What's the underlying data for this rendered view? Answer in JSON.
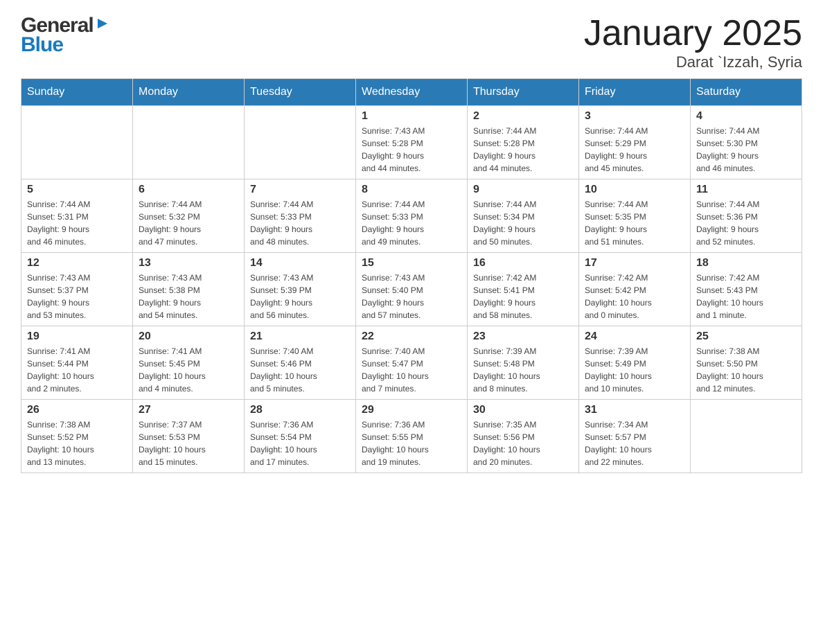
{
  "header": {
    "logo_general": "General",
    "logo_blue": "Blue",
    "title": "January 2025",
    "subtitle": "Darat `Izzah, Syria"
  },
  "days_of_week": [
    "Sunday",
    "Monday",
    "Tuesday",
    "Wednesday",
    "Thursday",
    "Friday",
    "Saturday"
  ],
  "weeks": [
    [
      {
        "day": "",
        "info": ""
      },
      {
        "day": "",
        "info": ""
      },
      {
        "day": "",
        "info": ""
      },
      {
        "day": "1",
        "info": "Sunrise: 7:43 AM\nSunset: 5:28 PM\nDaylight: 9 hours\nand 44 minutes."
      },
      {
        "day": "2",
        "info": "Sunrise: 7:44 AM\nSunset: 5:28 PM\nDaylight: 9 hours\nand 44 minutes."
      },
      {
        "day": "3",
        "info": "Sunrise: 7:44 AM\nSunset: 5:29 PM\nDaylight: 9 hours\nand 45 minutes."
      },
      {
        "day": "4",
        "info": "Sunrise: 7:44 AM\nSunset: 5:30 PM\nDaylight: 9 hours\nand 46 minutes."
      }
    ],
    [
      {
        "day": "5",
        "info": "Sunrise: 7:44 AM\nSunset: 5:31 PM\nDaylight: 9 hours\nand 46 minutes."
      },
      {
        "day": "6",
        "info": "Sunrise: 7:44 AM\nSunset: 5:32 PM\nDaylight: 9 hours\nand 47 minutes."
      },
      {
        "day": "7",
        "info": "Sunrise: 7:44 AM\nSunset: 5:33 PM\nDaylight: 9 hours\nand 48 minutes."
      },
      {
        "day": "8",
        "info": "Sunrise: 7:44 AM\nSunset: 5:33 PM\nDaylight: 9 hours\nand 49 minutes."
      },
      {
        "day": "9",
        "info": "Sunrise: 7:44 AM\nSunset: 5:34 PM\nDaylight: 9 hours\nand 50 minutes."
      },
      {
        "day": "10",
        "info": "Sunrise: 7:44 AM\nSunset: 5:35 PM\nDaylight: 9 hours\nand 51 minutes."
      },
      {
        "day": "11",
        "info": "Sunrise: 7:44 AM\nSunset: 5:36 PM\nDaylight: 9 hours\nand 52 minutes."
      }
    ],
    [
      {
        "day": "12",
        "info": "Sunrise: 7:43 AM\nSunset: 5:37 PM\nDaylight: 9 hours\nand 53 minutes."
      },
      {
        "day": "13",
        "info": "Sunrise: 7:43 AM\nSunset: 5:38 PM\nDaylight: 9 hours\nand 54 minutes."
      },
      {
        "day": "14",
        "info": "Sunrise: 7:43 AM\nSunset: 5:39 PM\nDaylight: 9 hours\nand 56 minutes."
      },
      {
        "day": "15",
        "info": "Sunrise: 7:43 AM\nSunset: 5:40 PM\nDaylight: 9 hours\nand 57 minutes."
      },
      {
        "day": "16",
        "info": "Sunrise: 7:42 AM\nSunset: 5:41 PM\nDaylight: 9 hours\nand 58 minutes."
      },
      {
        "day": "17",
        "info": "Sunrise: 7:42 AM\nSunset: 5:42 PM\nDaylight: 10 hours\nand 0 minutes."
      },
      {
        "day": "18",
        "info": "Sunrise: 7:42 AM\nSunset: 5:43 PM\nDaylight: 10 hours\nand 1 minute."
      }
    ],
    [
      {
        "day": "19",
        "info": "Sunrise: 7:41 AM\nSunset: 5:44 PM\nDaylight: 10 hours\nand 2 minutes."
      },
      {
        "day": "20",
        "info": "Sunrise: 7:41 AM\nSunset: 5:45 PM\nDaylight: 10 hours\nand 4 minutes."
      },
      {
        "day": "21",
        "info": "Sunrise: 7:40 AM\nSunset: 5:46 PM\nDaylight: 10 hours\nand 5 minutes."
      },
      {
        "day": "22",
        "info": "Sunrise: 7:40 AM\nSunset: 5:47 PM\nDaylight: 10 hours\nand 7 minutes."
      },
      {
        "day": "23",
        "info": "Sunrise: 7:39 AM\nSunset: 5:48 PM\nDaylight: 10 hours\nand 8 minutes."
      },
      {
        "day": "24",
        "info": "Sunrise: 7:39 AM\nSunset: 5:49 PM\nDaylight: 10 hours\nand 10 minutes."
      },
      {
        "day": "25",
        "info": "Sunrise: 7:38 AM\nSunset: 5:50 PM\nDaylight: 10 hours\nand 12 minutes."
      }
    ],
    [
      {
        "day": "26",
        "info": "Sunrise: 7:38 AM\nSunset: 5:52 PM\nDaylight: 10 hours\nand 13 minutes."
      },
      {
        "day": "27",
        "info": "Sunrise: 7:37 AM\nSunset: 5:53 PM\nDaylight: 10 hours\nand 15 minutes."
      },
      {
        "day": "28",
        "info": "Sunrise: 7:36 AM\nSunset: 5:54 PM\nDaylight: 10 hours\nand 17 minutes."
      },
      {
        "day": "29",
        "info": "Sunrise: 7:36 AM\nSunset: 5:55 PM\nDaylight: 10 hours\nand 19 minutes."
      },
      {
        "day": "30",
        "info": "Sunrise: 7:35 AM\nSunset: 5:56 PM\nDaylight: 10 hours\nand 20 minutes."
      },
      {
        "day": "31",
        "info": "Sunrise: 7:34 AM\nSunset: 5:57 PM\nDaylight: 10 hours\nand 22 minutes."
      },
      {
        "day": "",
        "info": ""
      }
    ]
  ]
}
